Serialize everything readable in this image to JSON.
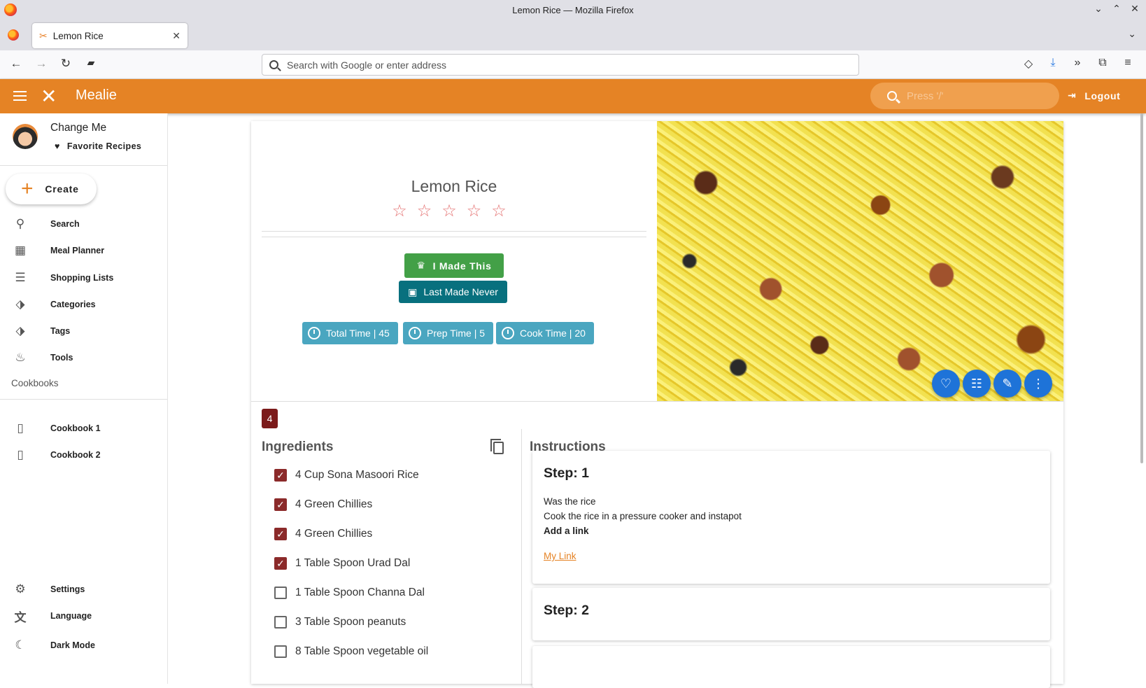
{
  "window": {
    "title": "Lemon Rice — Mozilla Firefox"
  },
  "tabs": [
    {
      "label": "Lemon Rice"
    }
  ],
  "urlbar": {
    "placeholder": "Search with Google or enter address"
  },
  "app": {
    "name": "Mealie",
    "search_placeholder": "Press '/'",
    "logout_label": "Logout"
  },
  "sidebar": {
    "user_name": "Change Me",
    "favorite_label": "Favorite Recipes",
    "create_label": "Create",
    "nav": [
      {
        "label": "Search",
        "icon": "search-icon"
      },
      {
        "label": "Meal Planner",
        "icon": "calendar-icon"
      },
      {
        "label": "Shopping Lists",
        "icon": "checklist-icon"
      },
      {
        "label": "Categories",
        "icon": "tags-icon"
      },
      {
        "label": "Tags",
        "icon": "tags-icon"
      },
      {
        "label": "Tools",
        "icon": "pot-icon"
      }
    ],
    "cookbooks_header": "Cookbooks",
    "cookbooks": [
      {
        "label": "Cookbook 1"
      },
      {
        "label": "Cookbook 2"
      }
    ],
    "bottom": [
      {
        "label": "Settings",
        "icon": "gear-icon"
      },
      {
        "label": "Language",
        "icon": "translate-icon"
      },
      {
        "label": "Dark Mode",
        "icon": "moon-icon"
      }
    ]
  },
  "recipe": {
    "title": "Lemon Rice",
    "rating": 0,
    "rating_max": 5,
    "made_this_label": "I Made This",
    "last_made_label": "Last Made Never",
    "times": [
      {
        "label": "Total Time | 45"
      },
      {
        "label": "Prep Time | 5"
      },
      {
        "label": "Cook Time | 20"
      }
    ],
    "servings_badge": "4",
    "ingredients_header": "Ingredients",
    "ingredients": [
      {
        "text": "4 Cup Sona Masoori Rice",
        "checked": true
      },
      {
        "text": "4 Green Chillies",
        "checked": true
      },
      {
        "text": "4 Green Chillies",
        "checked": true
      },
      {
        "text": "1 Table Spoon Urad Dal",
        "checked": true
      },
      {
        "text": "1 Table Spoon Channa Dal",
        "checked": false
      },
      {
        "text": "3 Table Spoon peanuts",
        "checked": false
      },
      {
        "text": "8 Table Spoon vegetable oil",
        "checked": false
      }
    ],
    "instructions_header": "Instructions",
    "steps": [
      {
        "title": "Step: 1",
        "lines": [
          "Was the rice",
          "Cook the rice in a pressure cooker and instapot"
        ],
        "bold_line": "Add a link",
        "link": "My Link"
      },
      {
        "title": "Step: 2"
      }
    ]
  },
  "colors": {
    "brand": "#e58325",
    "made_this": "#43a047",
    "last_made": "#08707e",
    "time_chip": "#4aa6c0",
    "fab": "#1e73d8",
    "check": "#8b2a2a"
  }
}
